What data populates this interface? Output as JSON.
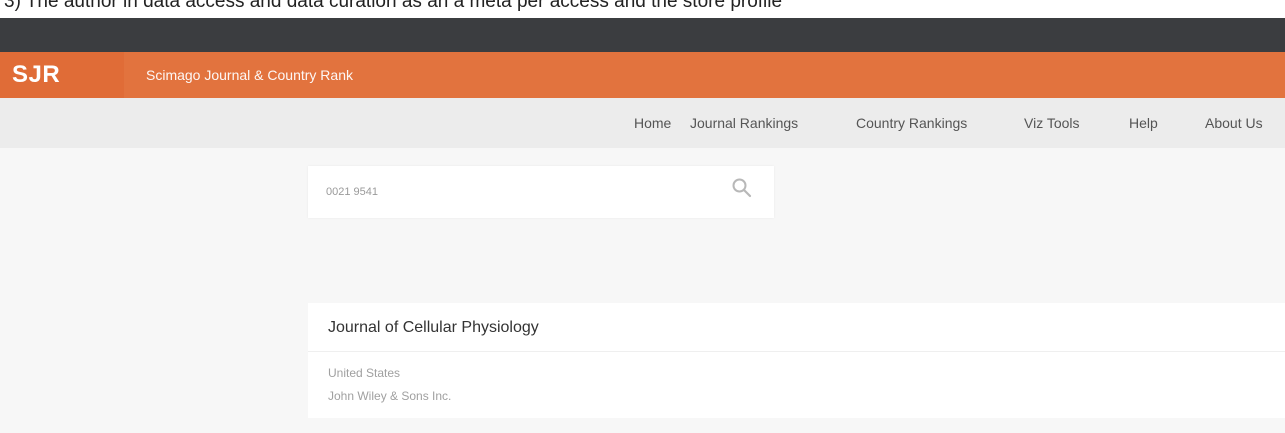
{
  "top_strip_text": "3) The author in data access and data curation as an a meta per access and the store profile",
  "brand": {
    "logo": "SJR",
    "site_title": "Scimago Journal & Country Rank"
  },
  "nav": {
    "items": [
      {
        "label": "Home"
      },
      {
        "label": "Journal Rankings"
      },
      {
        "label": "Country Rankings"
      },
      {
        "label": "Viz Tools"
      },
      {
        "label": "Help"
      },
      {
        "label": "About Us"
      }
    ]
  },
  "search": {
    "value": "0021 9541",
    "icon": "search-icon"
  },
  "result": {
    "title": "Journal of Cellular Physiology",
    "country": "United States",
    "publisher": "John Wiley & Sons Inc."
  },
  "colors": {
    "dark_bar": "#3b3d40",
    "orange_bar": "#e2733e",
    "nav_bg": "#ececec",
    "page_bg": "#f7f7f7"
  }
}
